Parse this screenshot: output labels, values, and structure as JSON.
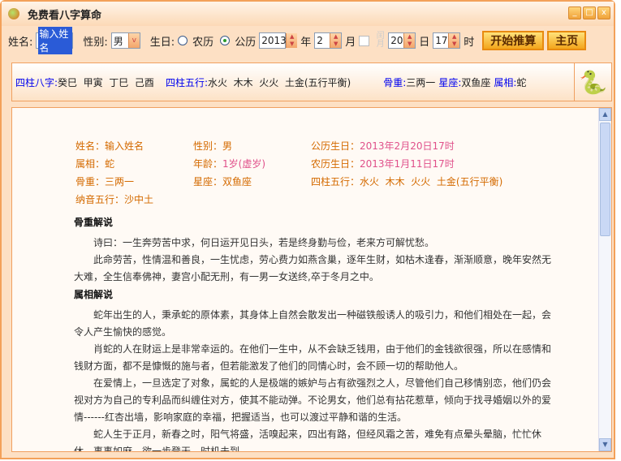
{
  "window": {
    "title": "免费看八字算命"
  },
  "toolbar": {
    "name_label": "姓名:",
    "name_value": "输入姓名",
    "gender_label": "性别:",
    "gender_value": "男",
    "birth_label": "生日:",
    "lunar": "农历",
    "solar": "公历",
    "year": "2013",
    "year_unit": "年",
    "month": "2",
    "month_unit": "月",
    "leap": "闰月",
    "day": "20",
    "day_unit": "日",
    "hour": "17",
    "hour_unit": "时",
    "start_button": "开始推算",
    "home_button": "主页"
  },
  "summary": {
    "bazi_label": "四柱八字:",
    "bazi": "癸巳  甲寅  丁巳  己酉",
    "wuxing_label": "四柱五行:",
    "wuxing": "水火  木木  火火  土金(五行平衡)",
    "gu_label": "骨重:",
    "gu": "三两一",
    "star_label": "星座:",
    "star": "双鱼座",
    "zodiac_label": "属相:",
    "zodiac": "蛇"
  },
  "details": {
    "name": "姓名：输入姓名",
    "gender": "性别：男",
    "solar_label": "公历生日：",
    "solar": "2013年2月20日17时",
    "zodiac": "属相：蛇",
    "age_label": "年龄：",
    "age": "1岁(虚岁)",
    "lunar_label": "农历生日：",
    "lunar": "2013年1月11日17时",
    "gu": "骨重：三两一",
    "star": "星座：双鱼座",
    "wuxing_label": "四柱五行：",
    "wuxing": "水火  木木  火火  土金(五行平衡)",
    "nayin": "纳音五行：沙中土"
  },
  "sections": [
    {
      "title": "骨重解说",
      "paras": [
        "诗曰：一生奔劳苦中求，何日运开见日头，若是终身勤与俭，老来方可解忧愁。",
        "此命劳苦，性情温和善良，一生忧虑，劳心费力如燕含巢，逐年生财，如枯木逢春，渐渐顺意，晚年安然无大难，全生信奉佛神，妻宫小配无刑，有一男一女送终,卒于冬月之中。"
      ]
    },
    {
      "title": "属相解说",
      "paras": [
        "蛇年出生的人，秉承蛇的原体素，其身体上自然会散发出一种磁铁般诱人的吸引力，和他们相处在一起，会令人产生愉快的感觉。",
        "肖蛇的人在财运上是非常幸运的。在他们一生中，从不会缺乏钱用，由于他们的金钱欲很强，所以在感情和钱财方面，都不是慷慨的施与者，但若能激发了他们的同情心时，会不顾一切的帮助他人。",
        "在爱情上，一旦选定了对象，属蛇的人是极端的嫉妒与占有欲强烈之人，尽管他们自己移情别恋，他们仍会视对方为自己的专利品而纠缠住对方，使其不能动弹。不论男女，他们总有拈花惹草，倾向于找寻婚姻以外的爱情------红杏出墙，影响家庭的幸福，把握适当，也可以渡过平静和谐的生活。",
        "蛇人生于正月，新春之时，阳气将盛，活嗅起来，四出有路，但经风霜之苦，难免有点晕头晕脑，忙忙休休，事事如麻，欲一步登天，时机未到。"
      ]
    }
  ]
}
